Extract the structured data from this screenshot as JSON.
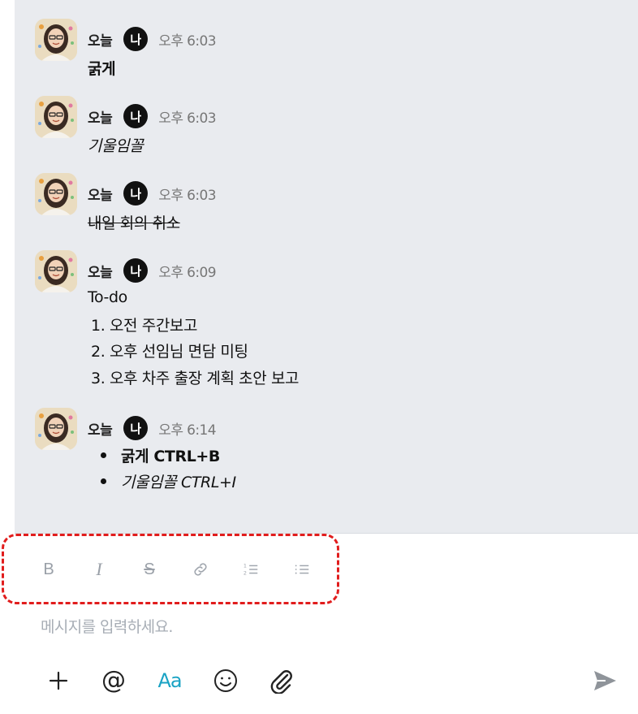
{
  "messages": [
    {
      "sender": "오늘",
      "badge": "나",
      "time": "오후 6:03",
      "text": "굵게",
      "style": "bold"
    },
    {
      "sender": "오늘",
      "badge": "나",
      "time": "오후 6:03",
      "text": "기울임꼴",
      "style": "italic"
    },
    {
      "sender": "오늘",
      "badge": "나",
      "time": "오후 6:03",
      "text": "내일 회의 취소",
      "style": "strike"
    },
    {
      "sender": "오늘",
      "badge": "나",
      "time": "오후 6:09",
      "text": "To-do",
      "list": [
        "1. 오전 주간보고",
        "2. 오후 선임님 면담 미팅",
        "3. 오후 차주 출장 계획 초안 보고"
      ]
    },
    {
      "sender": "오늘",
      "badge": "나",
      "time": "오후 6:14",
      "bullets": [
        "굵게 CTRL+B",
        "기울임꼴 CTRL+I"
      ]
    }
  ],
  "format_toolbar": {
    "items": [
      {
        "icon": "bold-icon"
      },
      {
        "icon": "italic-icon"
      },
      {
        "icon": "strikethrough-icon"
      },
      {
        "icon": "link-icon"
      },
      {
        "icon": "numbered-list-icon"
      },
      {
        "icon": "bulleted-list-icon"
      }
    ],
    "highlight_color": "#e11d1d"
  },
  "composer": {
    "placeholder": "메시지를 입력하세요.",
    "actions": [
      "plus-icon",
      "mention-icon",
      "text-format-icon",
      "emoji-icon",
      "attachment-icon"
    ],
    "send_icon": "send-icon",
    "accent": "#1aa3c4"
  }
}
